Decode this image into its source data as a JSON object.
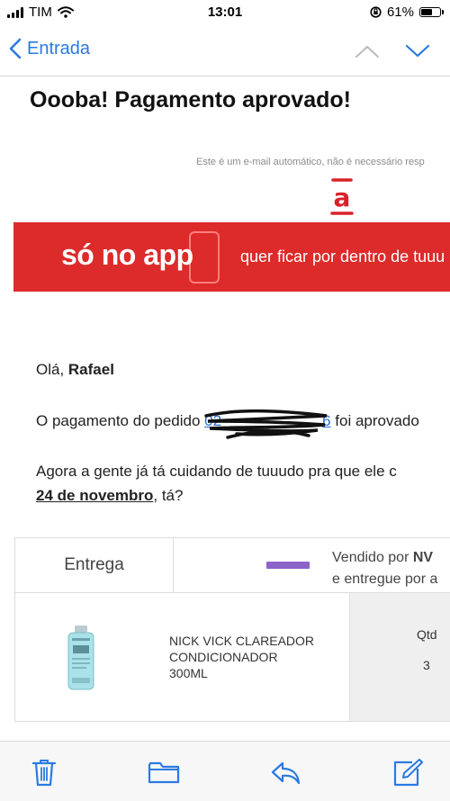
{
  "status_bar": {
    "carrier": "TIM",
    "time": "13:01",
    "battery": "61%",
    "battery_level": 0.61
  },
  "nav": {
    "back_label": "Entrada",
    "icons": [
      "chevron-left-icon",
      "chevron-up-icon",
      "chevron-down-icon"
    ]
  },
  "email": {
    "subject": "Oooba! Pagamento aprovado!",
    "auto_note": "Este é um e-mail automático, não é necessário resp",
    "logo_glyph": "a",
    "banner": {
      "headline": "só no app",
      "subtext": "quer ficar por dentro de tuuu"
    },
    "greeting_prefix": "Olá, ",
    "greeting_name": "Rafael",
    "payment_prefix": "O pagamento do pedido ",
    "order_number_visible_start": "02",
    "order_number_visible_end": "6",
    "payment_suffix": " foi aprovado",
    "tracking_line": "Agora a gente já tá cuidando de tuuudo pra que ele c",
    "date": "24 de novembro",
    "date_suffix": ", tá?",
    "table": {
      "delivery_label": "Entrega",
      "sold_by_prefix": "Vendido por ",
      "sold_by_name": "NV",
      "delivered_by": "e entregue por a",
      "product_name_line1": "NICK VICK CLAREADOR",
      "product_name_line2": "CONDICIONADOR",
      "product_name_line3": "300ML",
      "qty_header": "Qtd",
      "qty_value": "3"
    }
  },
  "toolbar": {
    "icons": [
      "trash-icon",
      "folder-icon",
      "reply-icon",
      "compose-icon"
    ]
  },
  "colors": {
    "accent": "#2a7ae2",
    "brand_red": "#dd2a2a",
    "link": "#2a6ed2",
    "seller_purple": "#8c63c7"
  }
}
